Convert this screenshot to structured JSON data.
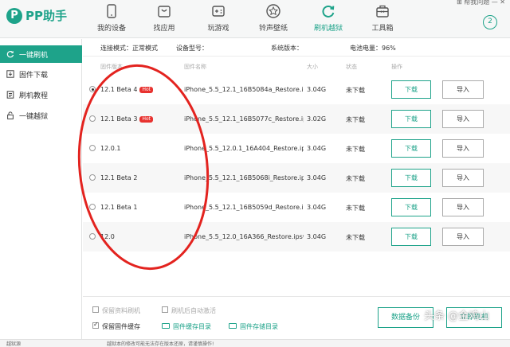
{
  "app": {
    "logo_mark": "P",
    "name": "PP助手"
  },
  "window_controls": "⊞ 帮我问题 — ✕",
  "nav": [
    {
      "label": "我的设备",
      "icon": "phone-icon"
    },
    {
      "label": "找应用",
      "icon": "store-bag-icon"
    },
    {
      "label": "玩游戏",
      "icon": "gamepad-icon"
    },
    {
      "label": "铃声壁纸",
      "icon": "star-icon"
    },
    {
      "label": "刷机越狱",
      "icon": "refresh-icon",
      "active": true
    },
    {
      "label": "工具箱",
      "icon": "toolbox-icon"
    }
  ],
  "help_badge": "2",
  "sidebar": [
    {
      "label": "一键刷机",
      "icon": "refresh-icon",
      "active": true
    },
    {
      "label": "固件下载",
      "icon": "download-icon"
    },
    {
      "label": "刷机教程",
      "icon": "document-icon"
    },
    {
      "label": "一键越狱",
      "icon": "lock-icon"
    }
  ],
  "info": {
    "conn_mode_label": "连接模式：正常模式",
    "model_label": "设备型号：",
    "version_label": "系统版本：",
    "battery_label": "电池电量：96%"
  },
  "table": {
    "headers": [
      "固件版本",
      "固件名称",
      "大小",
      "状态",
      "操作"
    ],
    "rows": [
      {
        "version": "12.1 Beta 4",
        "hot": "Hot",
        "file": "iPhone_5.5_12.1_16B5084a_Restore.ip...",
        "size": "3.04G",
        "status": "未下载",
        "selected": true
      },
      {
        "version": "12.1 Beta 3",
        "hot": "Hot",
        "file": "iPhone_5.5_12.1_16B5077c_Restore.ip...",
        "size": "3.02G",
        "status": "未下载",
        "selected": false
      },
      {
        "version": "12.0.1",
        "hot": "",
        "file": "iPhone_5.5_12.0.1_16A404_Restore.ip...",
        "size": "3.04G",
        "status": "未下载",
        "selected": false
      },
      {
        "version": "12.1 Beta 2",
        "hot": "",
        "file": "iPhone_5.5_12.1_16B5068i_Restore.ip...",
        "size": "3.04G",
        "status": "未下载",
        "selected": false
      },
      {
        "version": "12.1 Beta 1",
        "hot": "",
        "file": "iPhone_5.5_12.1_16B5059d_Restore.ip...",
        "size": "3.04G",
        "status": "未下载",
        "selected": false
      },
      {
        "version": "12.0",
        "hot": "",
        "file": "iPhone_5.5_12.0_16A366_Restore.ipsw",
        "size": "3.04G",
        "status": "未下载",
        "selected": false
      }
    ],
    "download_label": "下载",
    "import_label": "导入"
  },
  "bottom": {
    "keep_data": "保留资料刷机",
    "auto_activate": "刷机后自动激活",
    "keep_firmware": "保留固件缓存",
    "cache_dir": "固件缓存目录",
    "store_dir": "固件存储目录",
    "backup_button": "数据备份",
    "flash_button": "立即刷机"
  },
  "status_bar": {
    "left": "越狱源",
    "notice": "越狱本的修改可能无法存在版本还原，请谨慎操作!"
  },
  "watermark": "头条 @金鸡山"
}
